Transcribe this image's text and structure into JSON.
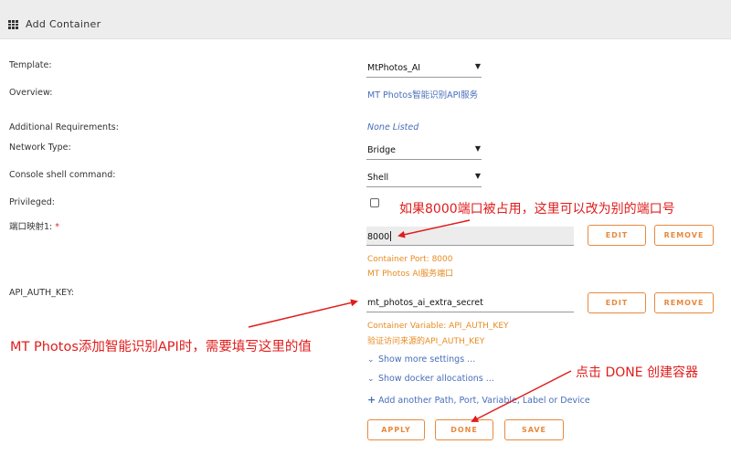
{
  "header": {
    "title": "Add Container",
    "icon": "grid-icon"
  },
  "form": {
    "template": {
      "label": "Template:",
      "value": "MtPhotos_AI"
    },
    "overview": {
      "label": "Overview:",
      "value": "MT Photos智能识别API服务"
    },
    "additional": {
      "label": "Additional Requirements:",
      "value": "None Listed"
    },
    "network": {
      "label": "Network Type:",
      "value": "Bridge"
    },
    "console": {
      "label": "Console shell command:",
      "value": "Shell"
    },
    "privileged": {
      "label": "Privileged:",
      "checked": false
    },
    "port": {
      "label": "端口映射1:",
      "required_mark": "*",
      "value": "8000",
      "edit_label": "EDIT",
      "remove_label": "REMOVE",
      "info1": "Container Port: 8000",
      "info2": "MT Photos AI服务端口"
    },
    "api_key": {
      "label": "API_AUTH_KEY:",
      "value": "mt_photos_ai_extra_secret",
      "edit_label": "EDIT",
      "remove_label": "REMOVE",
      "info1": "Container Variable: API_AUTH_KEY",
      "info2": "验证访问来源的API_AUTH_KEY"
    },
    "show_more": "Show more settings ...",
    "show_docker": "Show docker allocations ...",
    "add_another": "Add another Path, Port, Variable, Label or Device",
    "buttons": {
      "apply": "APPLY",
      "done": "DONE",
      "save": "SAVE"
    }
  },
  "annotations": {
    "port_note": "如果8000端口被占用，这里可以改为别的端口号",
    "key_note": "MT Photos添加智能识别API时，需要填写这里的值",
    "done_note": "点击 DONE 创建容器"
  },
  "colors": {
    "accent": "#e8893d",
    "link": "#486dba",
    "annotation": "#e01c1c"
  }
}
